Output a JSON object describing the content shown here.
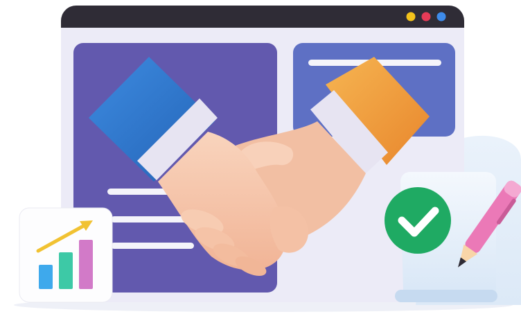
{
  "illustration": {
    "window_dots": [
      {
        "name": "yellow-window-dot",
        "color": "#F3C21B"
      },
      {
        "name": "red-window-dot",
        "color": "#E63B57"
      },
      {
        "name": "blue-window-dot",
        "color": "#3E8BEA"
      }
    ],
    "icons": {
      "handshake": "handshake-icon",
      "bar_chart": "bar-chart-icon",
      "checkmark": "checkmark-icon",
      "pen": "pen-icon"
    },
    "colors": {
      "window_bar": "#2F2C36",
      "window_body": "#ECEBF7",
      "left_panel": "#6259AE",
      "right_panel": "#5E70C4",
      "left_sleeve": "#2F7AD0",
      "right_sleeve": "#F0A23A",
      "skin": "#F6C7AA",
      "check_badge": "#1FAA63",
      "pen": "#EB79B7",
      "bar_blue": "#3EA9EC",
      "bar_green": "#3DC9A6",
      "bar_pink": "#D27AC8",
      "trend_arrow": "#F1C232"
    }
  }
}
